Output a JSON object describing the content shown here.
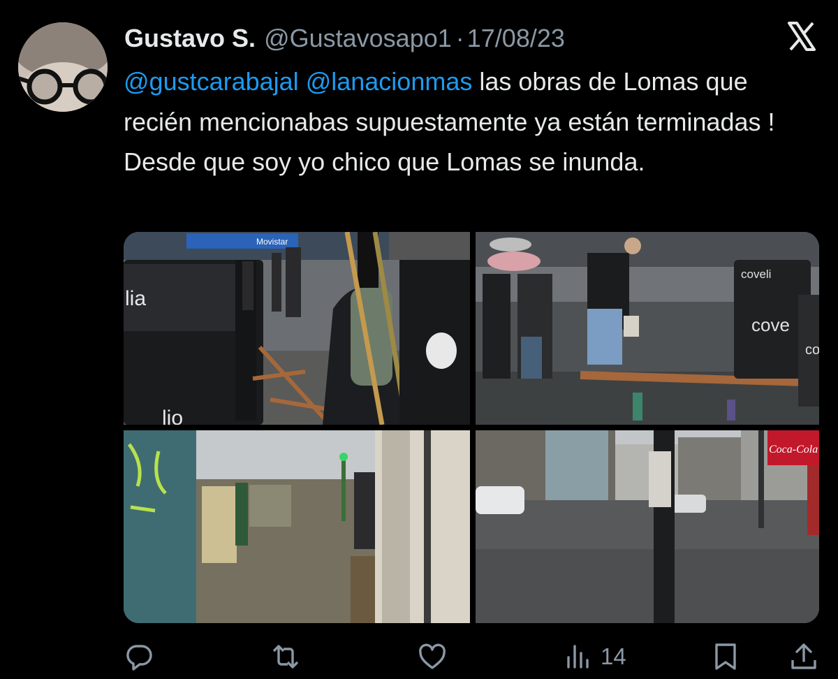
{
  "tweet": {
    "author_name": "Gustavo S.",
    "handle": "@Gustavosapo1",
    "separator": "·",
    "date": "17/08/23",
    "mention_1": "@gustcarabajal",
    "mention_2": "@lanacionmas",
    "body": " las obras de Lomas que recién mencionabas supuestamente ya están terminadas ! Desde que soy yo chico que Lomas se inunda."
  },
  "photos": {
    "p1": {
      "sign_movistar": "Movistar",
      "bin_text": "lia",
      "bin_text_lower": "lio"
    },
    "p2": {
      "bin_text_top": "coveli",
      "bin_text_mid": "cove",
      "bin_text_side": "co"
    },
    "p4": {
      "sign_brand": "Coca-Cola"
    }
  },
  "actions": {
    "views_count": "14"
  },
  "colors": {
    "background": "#000000",
    "text": "#e7e9ea",
    "secondary": "#8b98a5",
    "link": "#1d9bf0"
  },
  "icons": [
    "x-logo-icon",
    "reply-icon",
    "retweet-icon",
    "like-icon",
    "views-icon",
    "bookmark-icon",
    "share-icon"
  ]
}
